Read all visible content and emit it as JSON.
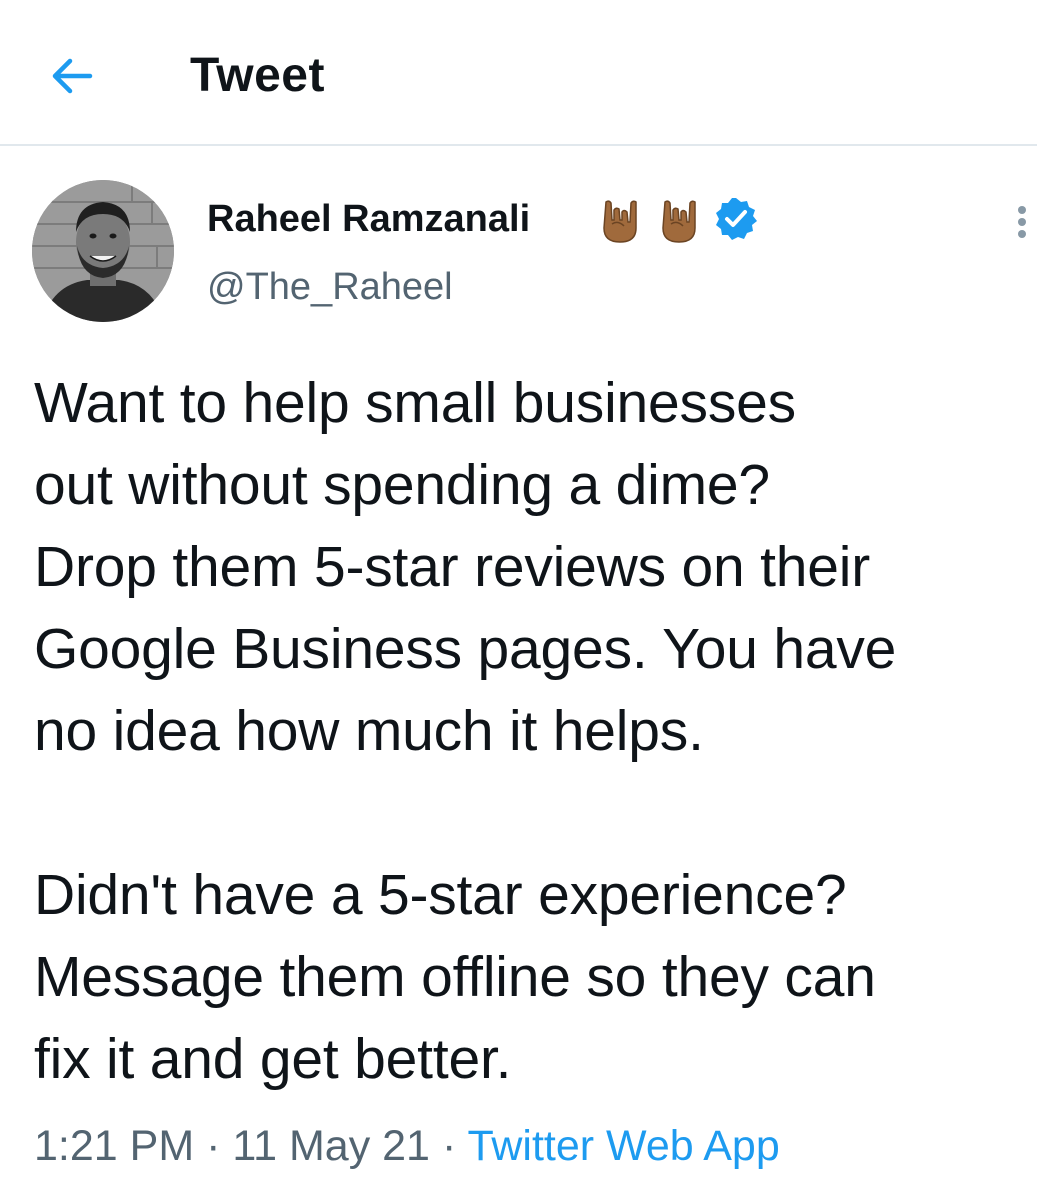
{
  "header": {
    "title": "Tweet",
    "back_icon": "arrow-left-icon",
    "accent_color": "#1d9bf0"
  },
  "author": {
    "name": "Raheel Ramzanali",
    "name_emojis": [
      "sign-of-the-horns-emoji",
      "sign-of-the-horns-emoji"
    ],
    "verified_icon": "verified-badge-icon",
    "handle": "@The_Raheel"
  },
  "tweet": {
    "lines": [
      "Want to help small businesses",
      "out without spending a dime?",
      "Drop them 5-star reviews on their",
      "Google Business pages. You have",
      "no idea how much it helps.",
      "",
      "Didn't have a 5-star experience?",
      "Message them offline so they can",
      "fix it and get better."
    ]
  },
  "meta": {
    "time": "1:21 PM",
    "separator": "·",
    "date": "11 May 21",
    "source": "Twitter Web App"
  }
}
